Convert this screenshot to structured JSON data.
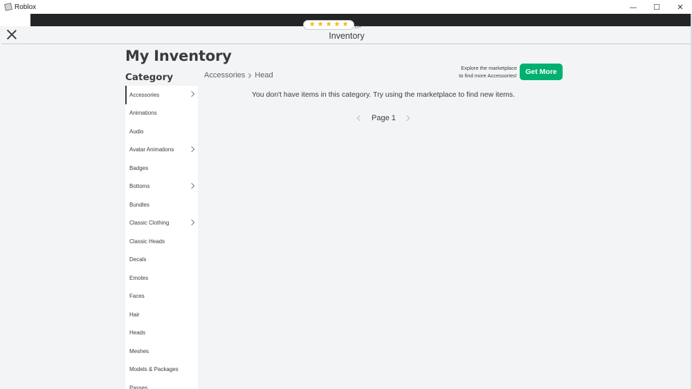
{
  "window": {
    "title": "Roblox",
    "controls": {
      "minimize": "—",
      "maximize": "☐",
      "close": "✕"
    }
  },
  "overlay": {
    "title": "Inventory",
    "rating": {
      "stars": 5,
      "age": "13+"
    }
  },
  "page": {
    "title": "My Inventory",
    "category_heading": "Category"
  },
  "categories": [
    {
      "label": "Accessories",
      "has_children": true,
      "active": true
    },
    {
      "label": "Animations",
      "has_children": false
    },
    {
      "label": "Audio",
      "has_children": false
    },
    {
      "label": "Avatar Animations",
      "has_children": true
    },
    {
      "label": "Badges",
      "has_children": false
    },
    {
      "label": "Bottoms",
      "has_children": true
    },
    {
      "label": "Bundles",
      "has_children": false
    },
    {
      "label": "Classic Clothing",
      "has_children": true
    },
    {
      "label": "Classic Heads",
      "has_children": false
    },
    {
      "label": "Decals",
      "has_children": false
    },
    {
      "label": "Emotes",
      "has_children": false
    },
    {
      "label": "Faces",
      "has_children": false
    },
    {
      "label": "Hair",
      "has_children": false
    },
    {
      "label": "Heads",
      "has_children": false
    },
    {
      "label": "Meshes",
      "has_children": false
    },
    {
      "label": "Models & Packages",
      "has_children": false
    },
    {
      "label": "Passes",
      "has_children": false
    }
  ],
  "breadcrumb": {
    "parent": "Accessories",
    "current": "Head"
  },
  "promo": {
    "line1": "Explore the marketplace",
    "line2": "to find more Accessories!",
    "button": "Get More"
  },
  "empty_message": "You don't have items in this category. Try using the marketplace to find new items.",
  "pagination": {
    "label": "Page 1"
  },
  "colors": {
    "accent": "#00b06f",
    "text": "#393b3d",
    "background": "#f2f4f5"
  }
}
